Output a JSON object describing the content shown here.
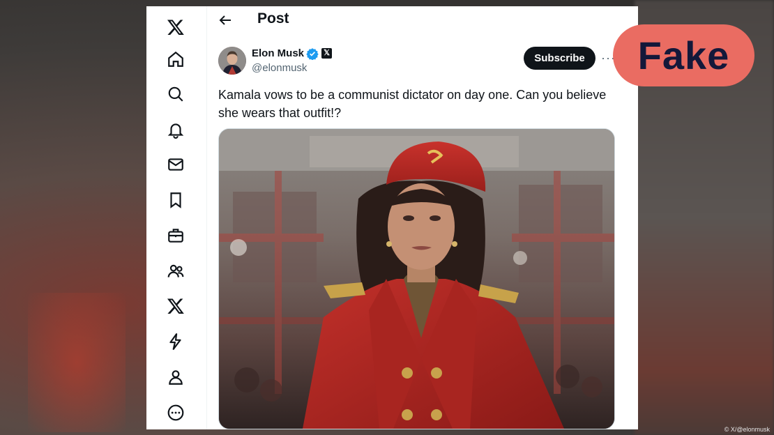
{
  "sidebar": {
    "items": [
      {
        "icon": "x-logo-icon"
      },
      {
        "icon": "home-icon"
      },
      {
        "icon": "search-icon"
      },
      {
        "icon": "bell-icon"
      },
      {
        "icon": "mail-icon"
      },
      {
        "icon": "bookmark-icon"
      },
      {
        "icon": "briefcase-icon"
      },
      {
        "icon": "people-icon"
      },
      {
        "icon": "x-premium-icon"
      },
      {
        "icon": "lightning-icon"
      },
      {
        "icon": "profile-icon"
      },
      {
        "icon": "more-circle-icon"
      }
    ]
  },
  "header": {
    "title": "Post"
  },
  "tweet": {
    "author_name": "Elon Musk",
    "handle": "@elonmusk",
    "subscribe_label": "Subscribe",
    "more_label": "···",
    "text": "Kamala vows to be a communist dictator on day one. Can you believe she wears that outfit!?"
  },
  "overlay": {
    "badge": "Fake",
    "credit": "© X/@elonmusk",
    "badge_color": "#ea6c62"
  },
  "colors": {
    "verified": "#1d9bf0",
    "text_primary": "#0f1419",
    "text_secondary": "#536471"
  }
}
